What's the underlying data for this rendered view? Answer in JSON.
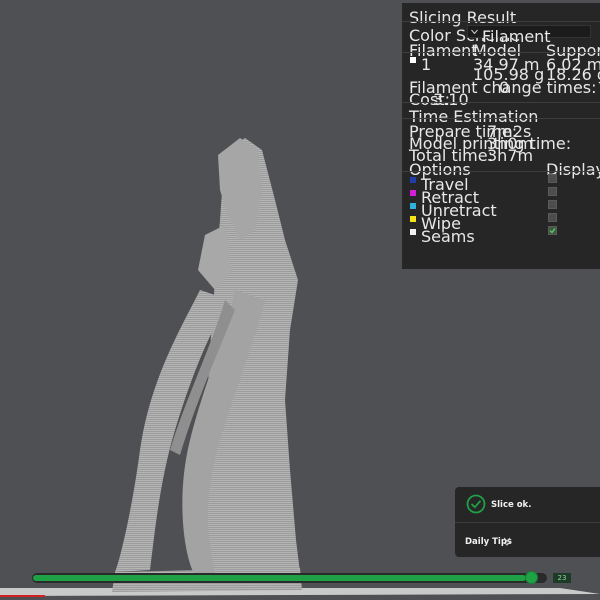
{
  "panel": {
    "title": "Slicing Result",
    "color_scheme_label": "Color Scheme",
    "color_scheme_value": "Filament",
    "table_headers": [
      "Filament",
      "Model",
      "Support"
    ],
    "filament_row": {
      "index": "1",
      "model_length": "34.97 m",
      "model_weight": "105.98 g",
      "support_length": "6.02 m",
      "support_weight": "18.26 g"
    },
    "filament_change_label": "Filament change times:",
    "filament_change_value": "0",
    "cost_label": "Cost:",
    "cost_value": "3.10",
    "time_title": "Time Estimation",
    "times": [
      {
        "label": "Prepare time:",
        "value": "7m2s"
      },
      {
        "label": "Model printing time:",
        "value": "3h0m"
      },
      {
        "label": "Total time:",
        "value": "3h7m"
      }
    ],
    "options_header": "Options",
    "display_header": "Display",
    "options": [
      {
        "label": "Travel",
        "color": "#1f3fa6",
        "checked": false
      },
      {
        "label": "Retract",
        "color": "#d21ed6",
        "checked": false
      },
      {
        "label": "Unretract",
        "color": "#2fb1e0",
        "checked": false
      },
      {
        "label": "Wipe",
        "color": "#f5e21a",
        "checked": false
      },
      {
        "label": "Seams",
        "color": "#f2f2f2",
        "checked": true
      }
    ]
  },
  "notification": {
    "message": "Slice ok.",
    "tips": "Daily Tips"
  },
  "slider": {
    "value_label": "23",
    "progress": 0.985
  },
  "colors": {
    "background": "#4f5053",
    "panel": "#262626",
    "accent_green": "#1ea245",
    "model": "#9a9a9a"
  },
  "icons": {
    "dropdown": "chevron-down-icon",
    "success": "check-circle-icon",
    "tips": "double-chevron-down-icon"
  }
}
